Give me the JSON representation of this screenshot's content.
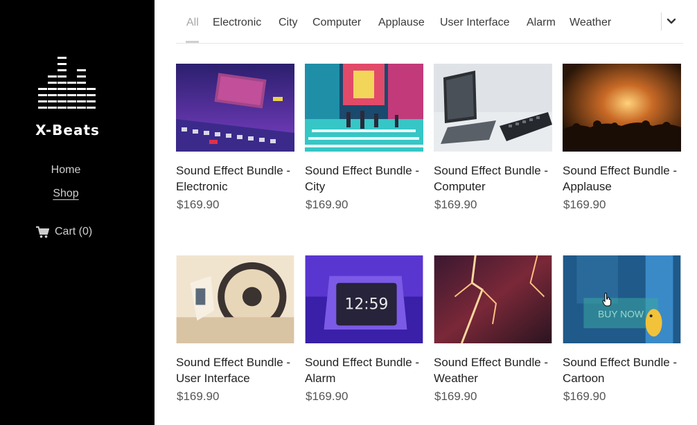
{
  "sidebar": {
    "brand": "X-Beats",
    "nav": [
      {
        "label": "Home"
      },
      {
        "label": "Shop"
      }
    ],
    "cart_label": "Cart (0)"
  },
  "filters": {
    "active": "All",
    "items": [
      "All",
      "Electronic",
      "City",
      "Computer",
      "Applause",
      "User Interface",
      "Alarm",
      "Weather"
    ]
  },
  "products": [
    {
      "title": "Sound Effect Bundle - Electronic",
      "price": "$169.90"
    },
    {
      "title": "Sound Effect Bundle - City",
      "price": "$169.90"
    },
    {
      "title": "Sound Effect Bundle - Computer",
      "price": "$169.90"
    },
    {
      "title": "Sound Effect Bundle - Applause",
      "price": "$169.90"
    },
    {
      "title": "Sound Effect Bundle - User Interface",
      "price": "$169.90"
    },
    {
      "title": "Sound Effect Bundle - Alarm",
      "price": "$169.90",
      "clock_text": "12:59"
    },
    {
      "title": "Sound Effect Bundle - Weather",
      "price": "$169.90"
    },
    {
      "title": "Sound Effect Bundle - Cartoon",
      "price": "$169.90",
      "overlay_text": "BUY NOW"
    }
  ]
}
